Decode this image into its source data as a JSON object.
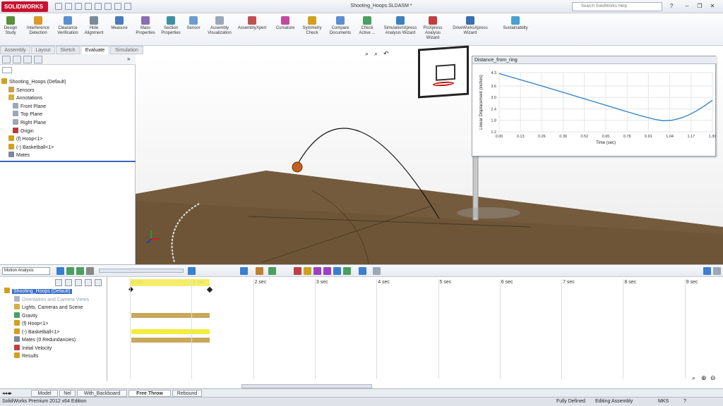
{
  "app": {
    "brand": "SOLIDWORKS",
    "doc_title": "Shooting_Hoops.SLDASM *",
    "search_placeholder": "Search SolidWorks Help"
  },
  "ribbon": [
    {
      "label": "Design Study",
      "icon": "design-study-icon",
      "color": "#5a8f3c"
    },
    {
      "label": "Interference Detection",
      "icon": "interference-icon",
      "color": "#d89a2a"
    },
    {
      "label": "Clearance Verification",
      "icon": "clearance-icon",
      "color": "#5b8fd0"
    },
    {
      "label": "Hole Alignment",
      "icon": "hole-alignment-icon",
      "color": "#7a8a9a"
    },
    {
      "label": "Measure",
      "icon": "measure-icon",
      "color": "#4a7bbd"
    },
    {
      "label": "Mass Properties",
      "icon": "mass-properties-icon",
      "color": "#8a6fb0"
    },
    {
      "label": "Section Properties",
      "icon": "section-properties-icon",
      "color": "#3f8fa0"
    },
    {
      "label": "Sensor",
      "icon": "sensor-icon",
      "color": "#6c9bd2"
    },
    {
      "label": "Assembly Visualization",
      "icon": "assembly-visualization-icon",
      "color": "#9aa8b8"
    },
    {
      "label": "AssemblyXpert",
      "icon": "assemblyxpert-icon",
      "color": "#c05050"
    },
    {
      "label": "Curvature",
      "icon": "curvature-icon",
      "color": "#c04aa0"
    },
    {
      "label": "Symmetry Check",
      "icon": "symmetry-check-icon",
      "color": "#d0a020"
    },
    {
      "label": "Compare Documents",
      "icon": "compare-documents-icon",
      "color": "#5b8fd0"
    },
    {
      "label": "Check Active ...",
      "icon": "check-active-icon",
      "color": "#4aa060"
    },
    {
      "label": "SimulationXpress Analysis Wizard",
      "icon": "simulationxpress-icon",
      "color": "#3f7fc0"
    },
    {
      "label": "FloXpress Analysis Wizard",
      "icon": "floxpress-icon",
      "color": "#c04040"
    },
    {
      "label": "DriveWorksXpress Wizard",
      "icon": "driveworksxpress-icon",
      "color": "#3a6fb0"
    },
    {
      "label": "Sustainability",
      "icon": "sustainability-icon",
      "color": "#4aa0d0"
    }
  ],
  "cm_tabs": [
    "Assembly",
    "Layout",
    "Sketch",
    "Evaluate",
    "Simulation"
  ],
  "active_tab": "Evaluate",
  "feature_tree": [
    {
      "label": "Shooting_Hoops  (Default)",
      "icon": "assembly-icon",
      "color": "#d0a020"
    },
    {
      "label": "Sensors",
      "icon": "sensors-icon",
      "color": "#c8a050"
    },
    {
      "label": "Annotations",
      "icon": "annotations-icon",
      "color": "#d0b040"
    },
    {
      "label": "Front Plane",
      "icon": "plane-icon",
      "color": "#9aa8b8"
    },
    {
      "label": "Top Plane",
      "icon": "plane-icon",
      "color": "#9aa8b8"
    },
    {
      "label": "Right Plane",
      "icon": "plane-icon",
      "color": "#9aa8b8"
    },
    {
      "label": "Origin",
      "icon": "origin-icon",
      "color": "#b04040"
    },
    {
      "label": "(f) Hoop<1>",
      "icon": "part-icon",
      "color": "#d0a020"
    },
    {
      "label": "(-) Basketball<1>",
      "icon": "part-icon",
      "color": "#d0a020"
    },
    {
      "label": "Mates",
      "icon": "mates-icon",
      "color": "#7a8a9a"
    }
  ],
  "graph": {
    "title": "Distance_from_ring",
    "xlabel": "Time (sec)",
    "ylabel": "Linear Displacement (inches)",
    "line_color": "#2f7fc1"
  },
  "chart_data": {
    "type": "line",
    "title": "Distance_from_ring",
    "xlabel": "Time (sec)",
    "ylabel": "Linear Displacement (inches)",
    "xlim": [
      0.0,
      1.3
    ],
    "ylim": [
      1.2,
      4.3
    ],
    "xticks": [
      "0.00",
      "0.13",
      "0.26",
      "0.39",
      "0.52",
      "0.65",
      "0.78",
      "0.91",
      "1.04",
      "1.17",
      "1.30"
    ],
    "yticks": [
      "1.2",
      "1.8",
      "2.4",
      "3.0",
      "3.6",
      "4.3"
    ],
    "series": [
      {
        "x": [
          0.0,
          0.1,
          0.2,
          0.3,
          0.4,
          0.5,
          0.6,
          0.7,
          0.8,
          0.88,
          0.95,
          1.0,
          1.05,
          1.1,
          1.15,
          1.2,
          1.25,
          1.3
        ],
        "y": [
          4.25,
          4.0,
          3.75,
          3.5,
          3.24,
          2.98,
          2.72,
          2.46,
          2.2,
          2.0,
          1.85,
          1.78,
          1.8,
          1.9,
          2.06,
          2.28,
          2.55,
          2.85
        ]
      }
    ]
  },
  "motion": {
    "study_type": "Motion Analysis",
    "time_labels": [
      "0 sec",
      "1 sec",
      "2 sec",
      "3 sec",
      "4 sec",
      "5 sec",
      "6 sec",
      "7 sec",
      "8 sec",
      "9 sec"
    ],
    "tree": [
      {
        "label": "Shooting_Hoops  (Default)",
        "color": "#d0a020"
      },
      {
        "label": "Orientation and Camera Views",
        "color": "#b0b8c4"
      },
      {
        "label": "Lights, Cameras and Scene",
        "color": "#d0b040"
      },
      {
        "label": "Gravity",
        "color": "#4aa060"
      },
      {
        "label": "(f) Hoop<1>",
        "color": "#d0a020"
      },
      {
        "label": "(-) Basketball<1>",
        "color": "#d0a020"
      },
      {
        "label": "Mates (0 Redundancies)",
        "color": "#7a8a9a"
      },
      {
        "label": "Initial Velocity",
        "color": "#c04040"
      },
      {
        "label": "Results",
        "color": "#d0a020"
      }
    ]
  },
  "bottom_tabs": [
    "Model",
    "Nel",
    "With_Backboard",
    "Free Throw",
    "Rebound"
  ],
  "active_bottom_tab": "Free Throw",
  "status": {
    "edition": "SolidWorks Premium 2012 x64 Edition",
    "state": "Fully Defined",
    "mode": "Editing Assembly",
    "units": "MKS"
  }
}
